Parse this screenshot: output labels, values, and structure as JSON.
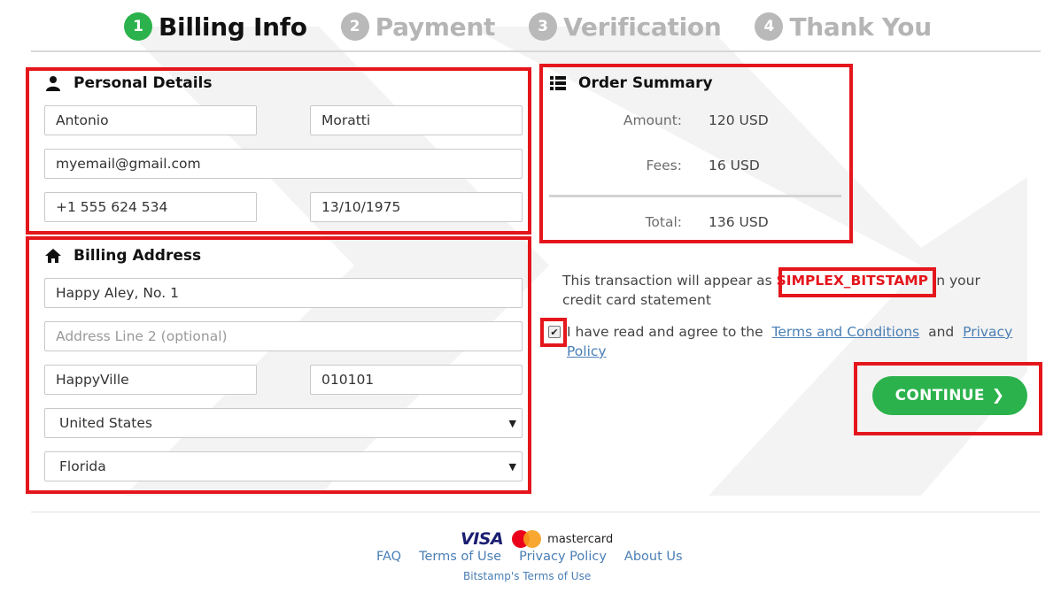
{
  "steps": [
    {
      "num": "1",
      "label": "Billing Info",
      "active": true
    },
    {
      "num": "2",
      "label": "Payment"
    },
    {
      "num": "3",
      "label": "Verification"
    },
    {
      "num": "4",
      "label": "Thank You"
    }
  ],
  "personal": {
    "title": "Personal Details",
    "first_name": "Antonio",
    "last_name": "Moratti",
    "email": "myemail@gmail.com",
    "phone": "+1 555 624 534",
    "dob": "13/10/1975"
  },
  "billing": {
    "title": "Billing Address",
    "address1": "Happy Aley, No. 1",
    "address2_placeholder": "Address Line 2 (optional)",
    "city": "HappyVille",
    "zip": "010101",
    "country": "United States",
    "state": "Florida"
  },
  "summary": {
    "title": "Order Summary",
    "amount_label": "Amount:",
    "amount_value": "120 USD",
    "fees_label": "Fees:",
    "fees_value": "16 USD",
    "total_label": "Total:",
    "total_value": "136 USD"
  },
  "statement": {
    "prefix": "This transaction will appear as",
    "code": "SIMPLEX_BITSTAMP",
    "suffix_line1": "in your",
    "suffix_line2": "credit card statement"
  },
  "agree": {
    "checked": true,
    "prefix": "I have read and agree to the",
    "terms": "Terms and Conditions",
    "and": "and",
    "privacy_1": "Privacy",
    "privacy_2": "Policy"
  },
  "continue_label": "CONTINUE",
  "footer": {
    "visa": "VISA",
    "mastercard": "mastercard",
    "links": [
      "FAQ",
      "Terms of Use",
      "Privacy Policy",
      "About Us"
    ],
    "sub": "Bitstamp's Terms of Use"
  },
  "colors": {
    "accent_green": "#2bb24c",
    "highlight_red": "#e4161c",
    "link_blue": "#4a7fb5"
  }
}
